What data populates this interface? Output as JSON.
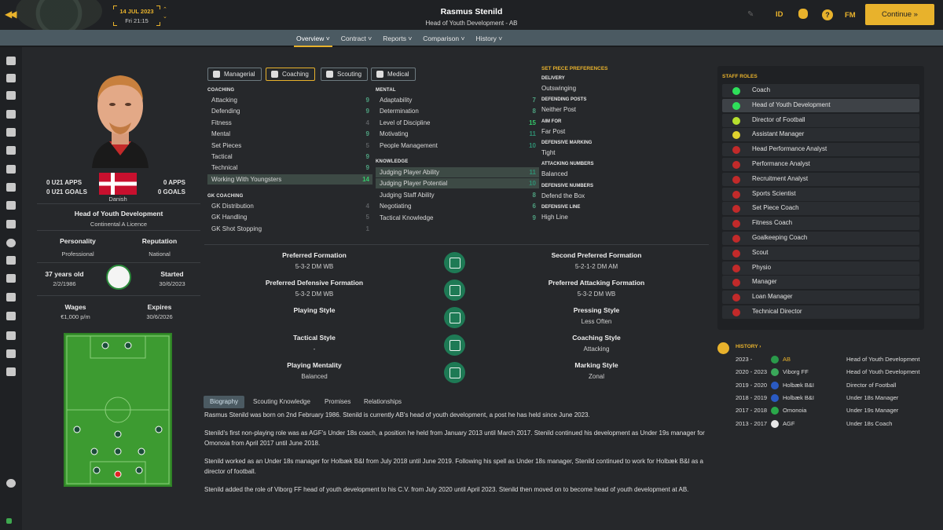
{
  "topbar": {
    "date": "14 JUL 2023",
    "time": "Fri 21:15",
    "id_label": "ID",
    "fm_label": "FM",
    "help_label": "?",
    "continue_label": "Continue »",
    "back_icon": "double-left-arrow-icon"
  },
  "person": {
    "name": "Rasmus Stenild",
    "subtitle": "Head of Youth Development - AB"
  },
  "nav": {
    "tabs": [
      "Overview ˅",
      "Contract ˅",
      "Reports ˅",
      "Comparison ˅",
      "History ˅"
    ]
  },
  "profile": {
    "u21_apps": "0 U21 APPS",
    "u21_goals": "0 U21 GOALS",
    "apps": "0 APPS",
    "goals": "0 GOALS",
    "nationality": "Danish",
    "role": "Head of Youth Development",
    "licence": "Continental A Licence",
    "personality_label": "Personality",
    "personality": "Professional",
    "reputation_label": "Reputation",
    "reputation": "National",
    "age": "37 years old",
    "dob": "2/2/1986",
    "started_label": "Started",
    "started": "30/6/2023",
    "wages_label": "Wages",
    "wages": "€1,000 p/m",
    "expires_label": "Expires",
    "expires": "30/6/2026"
  },
  "filters": [
    "Managerial",
    "Coaching",
    "Scouting",
    "Medical"
  ],
  "attributes": {
    "coaching_h": "COACHING",
    "coaching": [
      {
        "n": "Attacking",
        "v": "9"
      },
      {
        "n": "Defending",
        "v": "9"
      },
      {
        "n": "Fitness",
        "v": "4"
      },
      {
        "n": "Mental",
        "v": "9"
      },
      {
        "n": "Set Pieces",
        "v": "5"
      },
      {
        "n": "Tactical",
        "v": "9"
      },
      {
        "n": "Technical",
        "v": "9"
      },
      {
        "n": "Working With Youngsters",
        "v": "14"
      }
    ],
    "gk_h": "GK COACHING",
    "gk": [
      {
        "n": "GK Distribution",
        "v": "4"
      },
      {
        "n": "GK Handling",
        "v": "5"
      },
      {
        "n": "GK Shot Stopping",
        "v": "1"
      }
    ],
    "mental_h": "MENTAL",
    "mental": [
      {
        "n": "Adaptability",
        "v": "7"
      },
      {
        "n": "Determination",
        "v": "8"
      },
      {
        "n": "Level of Discipline",
        "v": "15"
      },
      {
        "n": "Motivating",
        "v": "11"
      },
      {
        "n": "People Management",
        "v": "10"
      }
    ],
    "knowledge_h": "KNOWLEDGE",
    "knowledge": [
      {
        "n": "Judging Player Ability",
        "v": "11"
      },
      {
        "n": "Judging Player Potential",
        "v": "10"
      },
      {
        "n": "Judging Staff Ability",
        "v": "8"
      },
      {
        "n": "Negotiating",
        "v": "6"
      },
      {
        "n": "Tactical Knowledge",
        "v": "9"
      }
    ]
  },
  "set_pieces": {
    "title": "SET PIECE PREFERENCES",
    "items": [
      {
        "h": "DELIVERY",
        "v": "Outswinging"
      },
      {
        "h": "DEFENDING POSTS",
        "v": "Neither Post"
      },
      {
        "h": "AIM FOR",
        "v": "Far Post"
      },
      {
        "h": "DEFENSIVE MARKING",
        "v": "Tight"
      },
      {
        "h": "ATTACKING NUMBERS",
        "v": "Balanced"
      },
      {
        "h": "DEFENSIVE NUMBERS",
        "v": "Defend the Box"
      },
      {
        "h": "DEFENSIVE LINE",
        "v": "High Line"
      }
    ]
  },
  "tactics": {
    "left": [
      {
        "t": "Preferred Formation",
        "v": "5-3-2 DM WB"
      },
      {
        "t": "Preferred Defensive Formation",
        "v": "5-3-2 DM WB"
      },
      {
        "t": "Playing Style",
        "v": ""
      },
      {
        "t": "Tactical Style",
        "v": "-"
      },
      {
        "t": "Playing Mentality",
        "v": "Balanced"
      }
    ],
    "right": [
      {
        "t": "Second Preferred Formation",
        "v": "5-2-1-2 DM AM"
      },
      {
        "t": "Preferred Attacking Formation",
        "v": "5-3-2 DM WB"
      },
      {
        "t": "Pressing Style",
        "v": "Less Often"
      },
      {
        "t": "Coaching Style",
        "v": "Attacking"
      },
      {
        "t": "Marking Style",
        "v": "Zonal"
      }
    ]
  },
  "bottom_tabs": [
    "Biography",
    "Scouting Knowledge",
    "Promises",
    "Relationships"
  ],
  "biography": [
    "Rasmus Stenild was born on 2nd February 1986. Stenild is currently AB's head of youth development, a post he has held since June 2023.",
    "Stenild's first non-playing role was as AGF's Under 18s coach, a position he held from January 2013 until March 2017. Stenild continued his development as Under 19s manager for Omonoia from April 2017 until June 2018.",
    "Stenild worked as an Under 18s manager for Holbæk B&I from July 2018 until June 2019. Following his spell as Under 18s manager, Stenild continued to work for Holbæk B&I as a director of football.",
    "Stenild added the role of Viborg FF head of youth development to his C.V. from July 2020 until April 2023. Stenild then moved on to become head of youth development at AB."
  ],
  "staff_roles": {
    "title": "STAFF ROLES",
    "items": [
      {
        "n": "Coach",
        "c": "#2ee05a"
      },
      {
        "n": "Head of Youth Development",
        "c": "#2ee05a"
      },
      {
        "n": "Director of Football",
        "c": "#b6e02e"
      },
      {
        "n": "Assistant Manager",
        "c": "#e0d22e"
      },
      {
        "n": "Head Performance Analyst",
        "c": "#c22a2a"
      },
      {
        "n": "Performance Analyst",
        "c": "#c22a2a"
      },
      {
        "n": "Recruitment Analyst",
        "c": "#c22a2a"
      },
      {
        "n": "Sports Scientist",
        "c": "#c22a2a"
      },
      {
        "n": "Set Piece Coach",
        "c": "#c22a2a"
      },
      {
        "n": "Fitness Coach",
        "c": "#c22a2a"
      },
      {
        "n": "Goalkeeping Coach",
        "c": "#c22a2a"
      },
      {
        "n": "Scout",
        "c": "#c22a2a"
      },
      {
        "n": "Physio",
        "c": "#c22a2a"
      },
      {
        "n": "Manager",
        "c": "#c22a2a"
      },
      {
        "n": "Loan Manager",
        "c": "#c22a2a"
      },
      {
        "n": "Technical Director",
        "c": "#c22a2a"
      }
    ]
  },
  "history": {
    "title": "HISTORY ›",
    "items": [
      {
        "y": "2023 -",
        "club": "AB",
        "role": "Head of Youth Development",
        "c": "#2a9a4a"
      },
      {
        "y": "2020 - 2023",
        "club": "Viborg FF",
        "role": "Head of Youth Development",
        "c": "#3aa85a"
      },
      {
        "y": "2019 - 2020",
        "club": "Holbæk B&I",
        "role": "Director of Football",
        "c": "#2a5ac2"
      },
      {
        "y": "2018 - 2019",
        "club": "Holbæk B&I",
        "role": "Under 18s Manager",
        "c": "#2a5ac2"
      },
      {
        "y": "2017 - 2018",
        "club": "Omonoia",
        "role": "Under 19s Manager",
        "c": "#2aa84a"
      },
      {
        "y": "2013 - 2017",
        "club": "AGF",
        "role": "Under 18s Coach",
        "c": "#e8e8e8"
      }
    ]
  },
  "colors": {
    "accent": "#e8b22c",
    "background": "#26282b",
    "nav": "#4b5a62",
    "highlight": "#3d4a45"
  }
}
